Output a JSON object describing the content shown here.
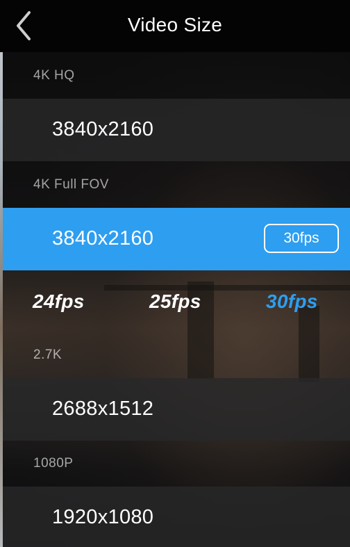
{
  "header": {
    "title": "Video Size",
    "back_icon": "chevron-left-icon"
  },
  "sections": [
    {
      "label": "4K HQ",
      "resolution": "3840x2160",
      "selected": false
    },
    {
      "label": "4K Full FOV",
      "resolution": "3840x2160",
      "selected": true,
      "fps_badge": "30fps"
    },
    {
      "label": "2.7K",
      "resolution": "2688x1512",
      "selected": false
    },
    {
      "label": "1080P",
      "resolution": "1920x1080",
      "selected": false
    }
  ],
  "fps_options": [
    {
      "label": "24fps",
      "active": false
    },
    {
      "label": "25fps",
      "active": false
    },
    {
      "label": "30fps",
      "active": true
    }
  ],
  "colors": {
    "accent": "#2e9ef0",
    "row_background": "#28282a",
    "header_background": "#040404",
    "text": "#ffffff"
  }
}
